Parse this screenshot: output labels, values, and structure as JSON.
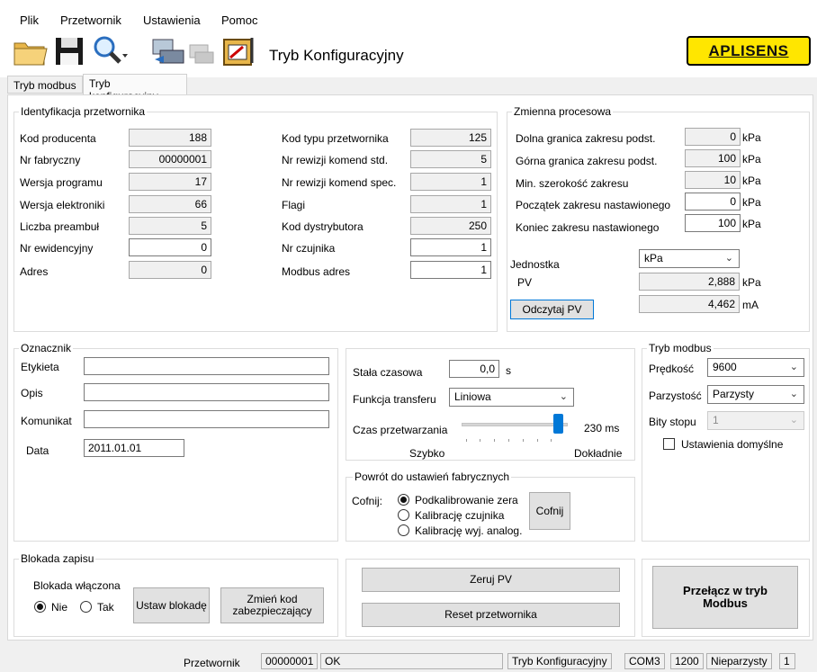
{
  "menu": {
    "file": "Plik",
    "transmitter": "Przetwornik",
    "settings": "Ustawienia",
    "help": "Pomoc"
  },
  "toolbar": {
    "title": "Tryb Konfiguracyjny",
    "logo": "APLISENS"
  },
  "tabs": {
    "modbus": "Tryb modbus",
    "config": "Tryb konfiguracyjny"
  },
  "ident": {
    "title": "Identyfikacja przetwornika",
    "left": [
      {
        "label": "Kod producenta",
        "value": "188"
      },
      {
        "label": "Nr fabryczny",
        "value": "00000001"
      },
      {
        "label": "Wersja programu",
        "value": "17"
      },
      {
        "label": "Wersja elektroniki",
        "value": "66"
      },
      {
        "label": "Liczba preambuł",
        "value": "5"
      },
      {
        "label": "Nr ewidencyjny",
        "value": "0"
      },
      {
        "label": "Adres",
        "value": "0"
      }
    ],
    "right": [
      {
        "label": "Kod typu przetwornika",
        "value": "125"
      },
      {
        "label": "Nr rewizji komend std.",
        "value": "5"
      },
      {
        "label": "Nr rewizji komend spec.",
        "value": "1"
      },
      {
        "label": "Flagi",
        "value": "1"
      },
      {
        "label": "Kod dystrybutora",
        "value": "250"
      },
      {
        "label": "Nr czujnika",
        "value": "1"
      },
      {
        "label": "Modbus adres",
        "value": "1"
      }
    ]
  },
  "process": {
    "title": "Zmienna procesowa",
    "rows": [
      {
        "label": "Dolna granica zakresu podst.",
        "value": "0",
        "unit": "kPa"
      },
      {
        "label": "Górna granica zakresu podst.",
        "value": "100",
        "unit": "kPa"
      },
      {
        "label": "Min. szerokość zakresu",
        "value": "10",
        "unit": "kPa"
      },
      {
        "label": "Początek zakresu nastawionego",
        "value": "0",
        "unit": "kPa"
      },
      {
        "label": "Koniec zakresu nastawionego",
        "value": "100",
        "unit": "kPa"
      }
    ],
    "unit_label": "Jednostka",
    "unit_value": "kPa",
    "pv_label": "PV",
    "pv_value": "2,888",
    "pv_unit": "kPa",
    "ma_value": "4,462",
    "ma_unit": "mA",
    "read_button": "Odczytaj PV"
  },
  "tag": {
    "title": "Oznacznik",
    "label_label": "Etykieta",
    "label_value": "",
    "desc_label": "Opis",
    "desc_value": "",
    "msg_label": "Komunikat",
    "msg_value": "",
    "date_label": "Data",
    "date_value": "2011.01.01"
  },
  "damping": {
    "time_label": "Stała czasowa",
    "time_value": "0,0",
    "time_unit": "s",
    "transfer_label": "Funkcja transferu",
    "transfer_value": "Liniowa",
    "proc_label": "Czas przetwarzania",
    "proc_value": "230 ms",
    "slider_level": 0.95,
    "fast": "Szybko",
    "accurate": "Dokładnie"
  },
  "factory": {
    "title": "Powrót do ustawień fabrycznych",
    "undo_label": "Cofnij:",
    "options": [
      "Podkalibrowanie zera",
      "Kalibrację czujnika",
      "Kalibrację wyj. analog."
    ],
    "selected": 0,
    "button": "Cofnij"
  },
  "modbus": {
    "title": "Tryb modbus",
    "speed_label": "Prędkość",
    "speed_value": "9600",
    "parity_label": "Parzystość",
    "parity_value": "Parzysty",
    "stop_label": "Bity stopu",
    "stop_value": "1",
    "defaults_label": "Ustawienia domyślne"
  },
  "lock": {
    "title": "Blokada zapisu",
    "enabled_label": "Blokada włączona",
    "no": "Nie",
    "yes": "Tak",
    "set_button": "Ustaw blokadę",
    "change_button": "Zmień kod zabezpieczający"
  },
  "actions": {
    "zero_pv": "Zeruj PV",
    "reset": "Reset przetwornika",
    "switch": "Przełącz w tryb Modbus"
  },
  "status": {
    "transmitter_label": "Przetwornik",
    "transmitter_value": "00000001",
    "state": "OK",
    "mode": "Tryb Konfiguracyjny",
    "port": "COM3",
    "baud": "1200",
    "parity": "Nieparzysty",
    "stop": "1"
  },
  "colors": {
    "accent": "#0078d7",
    "logo_bg": "#ffe600"
  }
}
